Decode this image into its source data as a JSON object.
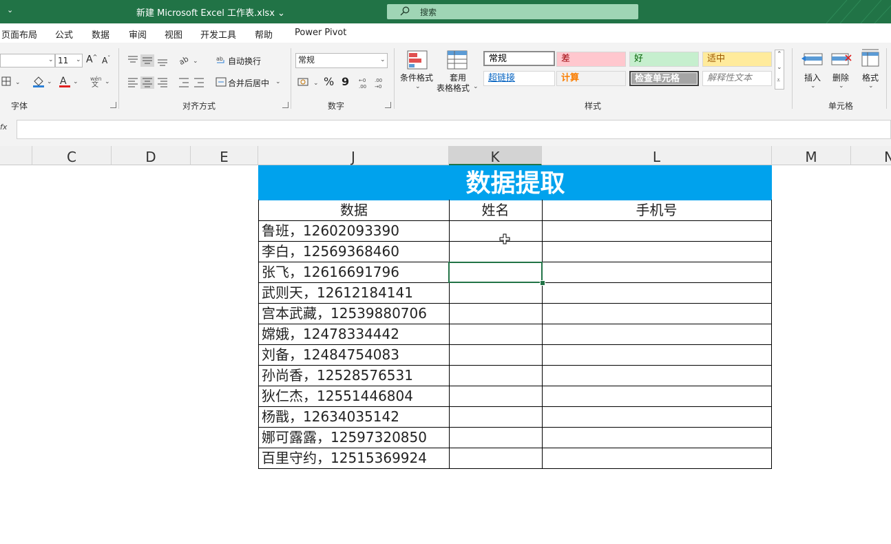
{
  "title_bar": {
    "document_title": "新建 Microsoft Excel 工作表.xlsx",
    "search_placeholder": "搜索"
  },
  "menu_tabs": [
    "页面布局",
    "公式",
    "数据",
    "审阅",
    "视图",
    "开发工具",
    "帮助",
    "Power Pivot"
  ],
  "ribbon": {
    "font": {
      "font_size": "11",
      "group_label": "字体"
    },
    "alignment": {
      "wrap_text": "自动换行",
      "merge_center": "合并后居中",
      "group_label": "对齐方式"
    },
    "number": {
      "format": "常规",
      "percent": "%",
      "comma": "9",
      "group_label": "数字"
    },
    "styles": {
      "conditional_format": "条件格式",
      "table_format_line1": "套用",
      "table_format_line2": "表格格式",
      "cells": [
        {
          "label": "常规",
          "color": "#ffffff",
          "text_color": "#000000"
        },
        {
          "label": "差",
          "color": "#ffc7ce",
          "text_color": "#9c0006"
        },
        {
          "label": "好",
          "color": "#c6efce",
          "text_color": "#006100"
        },
        {
          "label": "适中",
          "color": "#ffeb9c",
          "text_color": "#9c5700"
        },
        {
          "label": "超链接",
          "color": "#ffffff",
          "text_color": "#0563c1"
        },
        {
          "label": "计算",
          "color": "#f2f2f2",
          "text_color": "#fa7d00"
        },
        {
          "label": "检查单元格",
          "color": "#a5a5a5",
          "text_color": "#ffffff"
        },
        {
          "label": "解释性文本",
          "color": "#ffffff",
          "text_color": "#7f7f7f"
        }
      ],
      "group_label": "样式"
    },
    "cells_group": {
      "insert": "插入",
      "delete": "删除",
      "format": "格式",
      "group_label": "单元格"
    }
  },
  "formula_bar": {
    "fx": "fx",
    "value": ""
  },
  "columns": [
    "C",
    "D",
    "E",
    "J",
    "K",
    "L",
    "M",
    "N"
  ],
  "sheet": {
    "title": "数据提取",
    "headers": [
      "数据",
      "姓名",
      "手机号"
    ],
    "rows": [
      "鲁班，12602093390",
      "李白，12569368460",
      "张飞，12616691796",
      "武则天，12612184141",
      "宫本武藏，12539880706",
      "嫦娥，12478334442",
      "刘备，12484754083",
      "孙尚香，12528576531",
      "狄仁杰，12551446804",
      "杨戬，12634035142",
      "娜可露露，12597320850",
      "百里守约，12515369924"
    ]
  },
  "accent_color": "#217346",
  "title_fill_color": "#00a2ed"
}
